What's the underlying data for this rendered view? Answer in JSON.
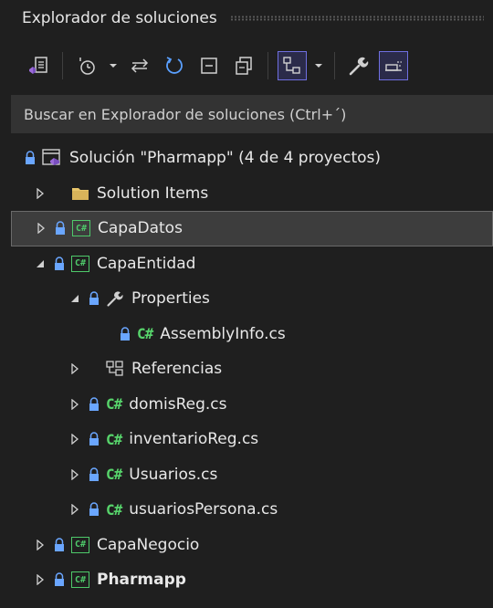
{
  "panel": {
    "title": "Explorador de soluciones"
  },
  "search": {
    "placeholder": "Buscar en Explorador de soluciones (Ctrl+´)"
  },
  "tree": {
    "solution": "Solución \"Pharmapp\"  (4 de 4 proyectos)",
    "items": [
      {
        "label": "Solution Items"
      },
      {
        "label": "CapaDatos"
      },
      {
        "label": "CapaEntidad"
      },
      {
        "label": "Properties"
      },
      {
        "label": "AssemblyInfo.cs"
      },
      {
        "label": "Referencias"
      },
      {
        "label": "domisReg.cs"
      },
      {
        "label": "inventarioReg.cs"
      },
      {
        "label": "Usuarios.cs"
      },
      {
        "label": "usuariosPersona.cs"
      },
      {
        "label": "CapaNegocio"
      },
      {
        "label": "Pharmapp"
      }
    ]
  },
  "colors": {
    "background": "#1f1f1f",
    "selection": "#3d3d3d",
    "csharp_green": "#57d46b",
    "lock_blue": "#6aa6ff",
    "accent_purple": "#6f6fe0"
  }
}
